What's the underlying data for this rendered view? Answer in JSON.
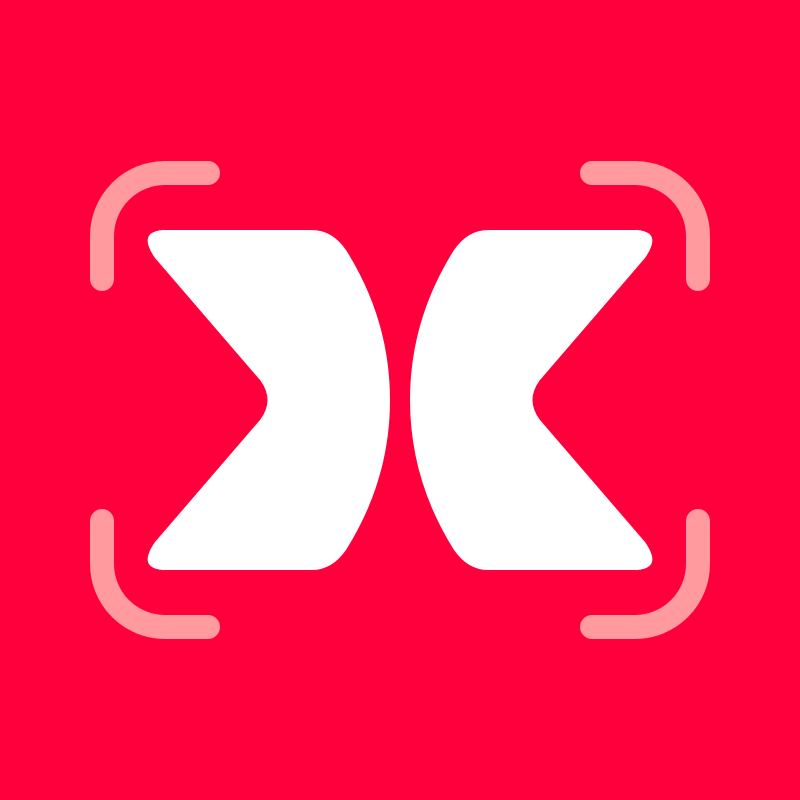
{
  "app_icon": {
    "icon": "scan-frame-logo-icon",
    "colors": {
      "background": "#FF003C",
      "mark": "#FFFFFF",
      "frame_corners": "#FF9A9E"
    }
  }
}
